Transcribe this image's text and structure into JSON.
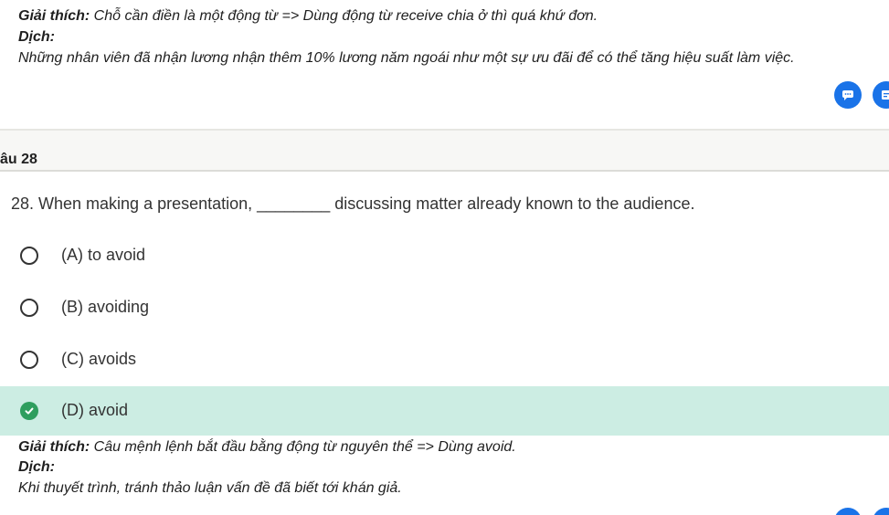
{
  "previous_explanation": {
    "explain_label": "Giải thích:",
    "explain_text": " Chỗ cần điền là một động từ => Dùng động từ receive chia ở thì quá khứ đơn.",
    "translate_label": "Dịch:",
    "translate_text": "Những nhân viên đã nhận lương nhận thêm 10% lương năm ngoái như một sự ưu đãi để có thể tăng hiệu suất làm việc."
  },
  "actions": {
    "chat_icon": "chat-bubble-icon",
    "note_icon": "note-icon"
  },
  "question_header": {
    "label": "âu 28"
  },
  "question": {
    "text": "28. When making a presentation, ________ discussing matter already known to the audience.",
    "options": [
      {
        "label": "(A) to avoid",
        "selected": false
      },
      {
        "label": "(B) avoiding",
        "selected": false
      },
      {
        "label": "(C) avoids",
        "selected": false
      },
      {
        "label": "(D) avoid",
        "selected": true
      }
    ]
  },
  "answer_explanation": {
    "explain_label": "Giải thích:",
    "explain_text": " Câu mệnh lệnh bắt đầu bằng động từ nguyên thể => Dùng avoid.",
    "translate_label": "Dịch:",
    "translate_text": "Khi thuyết trình, tránh thảo luận vấn đề đã biết tới khán giả."
  },
  "colors": {
    "accent_blue": "#1a73e8",
    "correct_bg": "#ccede3",
    "correct_check": "#2e9e5e"
  }
}
